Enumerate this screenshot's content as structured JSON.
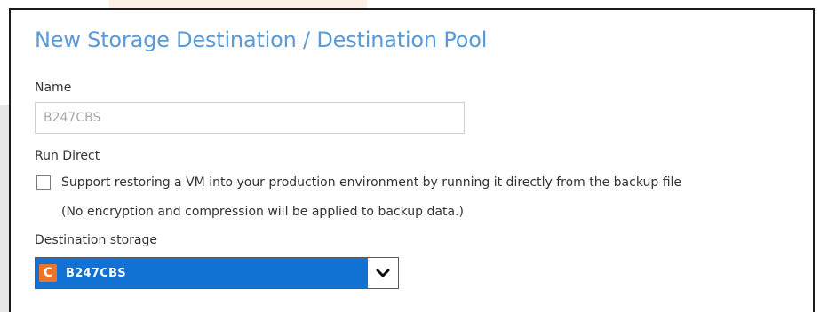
{
  "dialog": {
    "title": "New Storage Destination / Destination Pool"
  },
  "name_field": {
    "label": "Name",
    "value": "B247CBS"
  },
  "run_direct": {
    "label": "Run Direct",
    "checked": false,
    "checkbox_text": "Support restoring a VM into your production environment by running it directly from the backup file",
    "note": "(No encryption and compression will be applied to backup data.)"
  },
  "destination_storage": {
    "label": "Destination storage",
    "selected": "B247CBS",
    "icon_glyph": "C",
    "icon": "cloudbacko-c-icon",
    "arrow_icon": "chevron-down-icon"
  },
  "colors": {
    "title": "#5a9ad6",
    "select_highlight": "#1172d4",
    "app_icon": "#f07427"
  }
}
